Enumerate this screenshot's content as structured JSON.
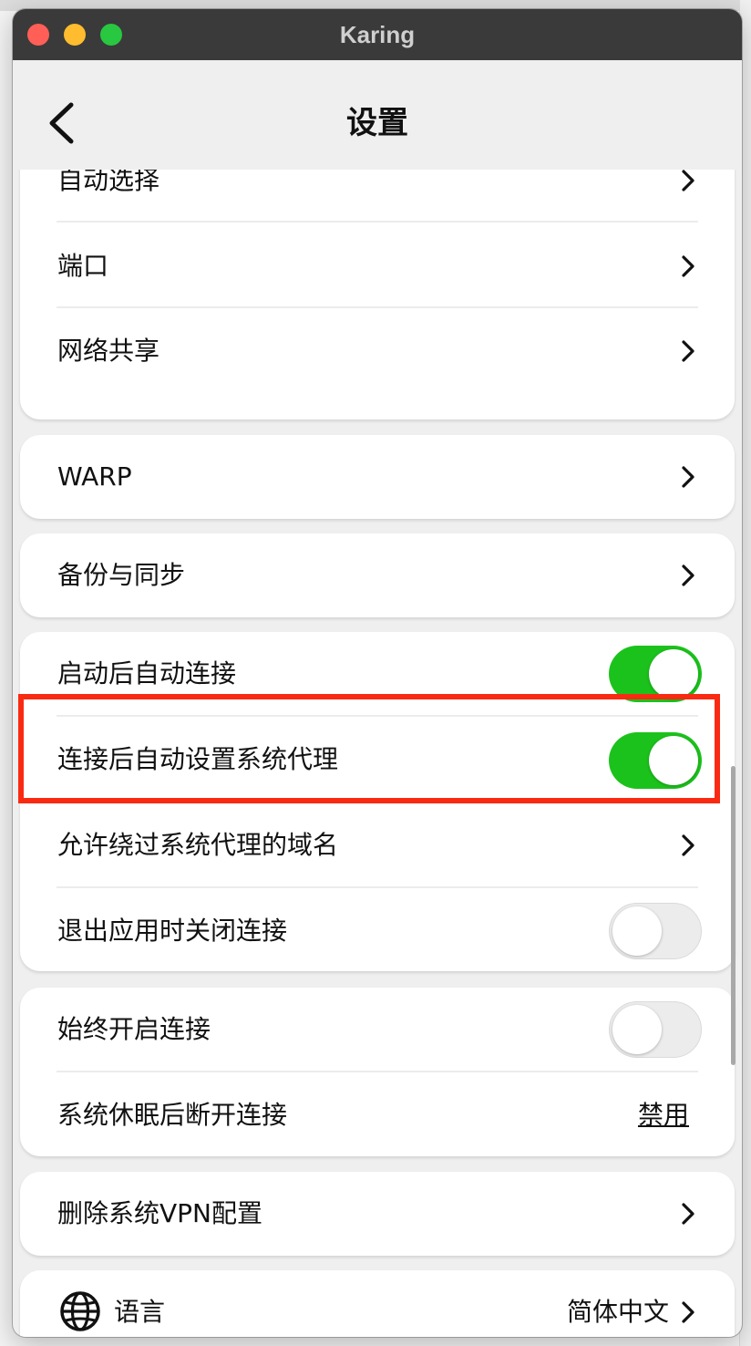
{
  "window": {
    "title": "Karing"
  },
  "header": {
    "title": "设置",
    "back_icon": "chevron-left-icon"
  },
  "colors": {
    "toggle_on": "#1cc21c",
    "toggle_off": "#ececec",
    "highlight": "#fa2a12",
    "titlebar": "#3a3a3a"
  },
  "settings": {
    "auto_select": "自动选择",
    "port": "端口",
    "network_sharing": "网络共享",
    "warp": "WARP",
    "backup_sync": "备份与同步",
    "auto_connect_on_launch": {
      "label": "启动后自动连接",
      "enabled": true
    },
    "auto_set_system_proxy": {
      "label": "连接后自动设置系统代理",
      "enabled": true
    },
    "bypass_domains": "允许绕过系统代理的域名",
    "close_on_exit": {
      "label": "退出应用时关闭连接",
      "enabled": false
    },
    "always_on": {
      "label": "始终开启连接",
      "enabled": false
    },
    "disconnect_on_sleep": {
      "label": "系统休眠后断开连接",
      "value": "禁用"
    },
    "delete_vpn_config": "删除系统VPN配置",
    "language": {
      "label": "语言",
      "value": "简体中文",
      "icon": "globe-icon"
    }
  }
}
